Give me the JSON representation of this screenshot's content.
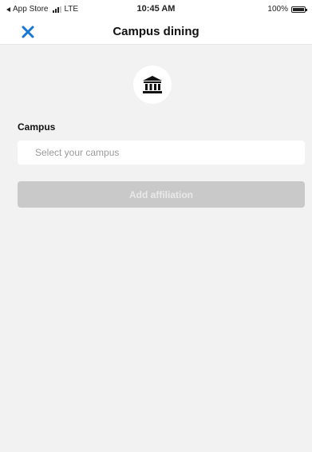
{
  "status_bar": {
    "back_label": "App Store",
    "carrier": "LTE",
    "time": "10:45 AM",
    "battery": "100%"
  },
  "nav": {
    "title": "Campus dining",
    "close_icon": "close-icon"
  },
  "form": {
    "icon": "bank-building-icon",
    "campus_label": "Campus",
    "campus_placeholder": "Select your campus",
    "submit_label": "Add affiliation"
  },
  "colors": {
    "accent": "#1877d4",
    "background": "#f2f2f2",
    "button_disabled": "#c9c9c9"
  }
}
